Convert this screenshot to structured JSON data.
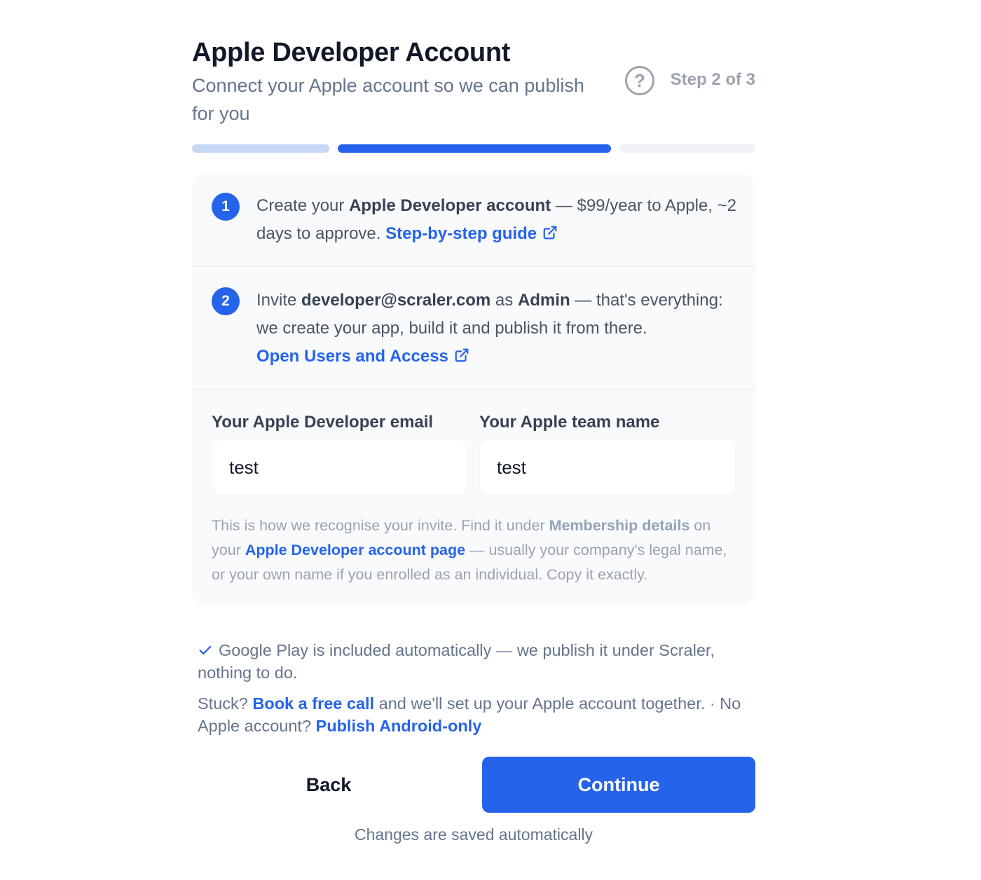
{
  "header": {
    "title": "Apple Developer Account",
    "subtitle": "Connect your Apple account so we can publish for you",
    "help_icon": "question-circle-icon",
    "step_text": "Step 2 of 3"
  },
  "progress": {
    "current_step": 2,
    "total_steps": 3
  },
  "steps": [
    {
      "number": "1",
      "pre": "Create your ",
      "bold": "Apple Developer account",
      "post": " — $99/year to Apple, ~2 days to approve. ",
      "link": "Step-by-step guide",
      "link_icon": "external-link-icon"
    },
    {
      "number": "2",
      "pre": "Invite ",
      "email": "developer@scraler.com",
      "mid": " as ",
      "role": "Admin",
      "post": " — that's everything: we create your app, build it and publish it from there.",
      "link": "Open Users and Access",
      "link_icon": "external-link-icon"
    }
  ],
  "form": {
    "email_label": "Your Apple Developer email",
    "email_value": "test",
    "team_label": "Your Apple team name",
    "team_value": "test",
    "hint_pre": "This is how we recognise your invite. Find it under ",
    "hint_bold": "Membership details",
    "hint_mid": " on your ",
    "hint_link": "Apple Developer account page",
    "hint_post": " — usually your company's legal name, or your own name if you enrolled as an individual. Copy it exactly."
  },
  "notes": {
    "google_play": "Google Play is included automatically — we publish it under Scraler, nothing to do.",
    "stuck_pre": "Stuck? ",
    "book_call": "Book a free call",
    "stuck_mid": " and we'll set up your Apple account together. · No Apple account? ",
    "android_only": "Publish Android-only"
  },
  "actions": {
    "back": "Back",
    "continue": "Continue",
    "saved": "Changes are saved automatically"
  },
  "colors": {
    "accent": "#2563eb",
    "progress_done": "#c7d7f6",
    "progress_todo": "#f1f3f7",
    "card_bg": "#f8fafc"
  }
}
